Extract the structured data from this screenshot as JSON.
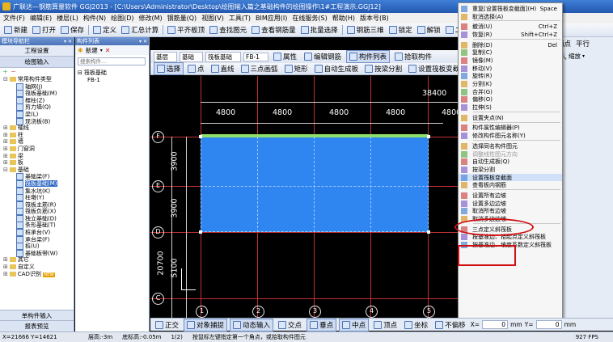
{
  "window": {
    "title": "广联达—钢筋算量软件 GGJ2013 - [C:\\Users\\Administrator\\Desktop\\绘图输入篇之基础构件的绘图操作\\1#工程演示.GGJ12]"
  },
  "menubar": [
    "文件(F)",
    "编辑(E)",
    "楼层(L)",
    "构件(N)",
    "绘图(D)",
    "修改(M)",
    "钢筋量(Q)",
    "视图(V)",
    "工具(T)",
    "BIM应用(I)",
    "在线服务(S)",
    "帮助(H)",
    "版本号(B)"
  ],
  "toolbar1": [
    "新建",
    "打开",
    "保存",
    "定义",
    "汇总计算",
    "平齐板顶",
    "查找图元",
    "查看钢筋量",
    "批量选择",
    "钢筋三维",
    "锁定",
    "解锁",
    "二维",
    "俯视",
    "动态观察"
  ],
  "toolbar2_right": [
    "两点",
    "平行",
    "点角",
    "三点辅轴",
    "删除辅轴",
    "尺寸标注"
  ],
  "nav_panel": {
    "title": "模块导航栏",
    "tabs": [
      "工程设置",
      "绘图输入"
    ],
    "bottom_tabs": [
      "单构件输入",
      "报表预览"
    ],
    "tree": [
      {
        "label": "常用构件类型",
        "level": 0,
        "exp": "-"
      },
      {
        "label": "轴网(J)",
        "level": 2
      },
      {
        "label": "筏板基础(M)",
        "level": 2
      },
      {
        "label": "框柱(Z)",
        "level": 2
      },
      {
        "label": "剪力墙(Q)",
        "level": 2
      },
      {
        "label": "梁(L)",
        "level": 2
      },
      {
        "label": "现浇板(B)",
        "level": 2
      },
      {
        "label": "轴线",
        "level": 0,
        "exp": "+"
      },
      {
        "label": "柱",
        "level": 0,
        "exp": "+"
      },
      {
        "label": "墙",
        "level": 0,
        "exp": "+"
      },
      {
        "label": "门窗洞",
        "level": 0,
        "exp": "+"
      },
      {
        "label": "梁",
        "level": 0,
        "exp": "+"
      },
      {
        "label": "板",
        "level": 0,
        "exp": "+"
      },
      {
        "label": "基础",
        "level": 0,
        "exp": "-"
      },
      {
        "label": "基础梁(F)",
        "level": 2
      },
      {
        "label": "筏板基础(M)",
        "level": 2,
        "sel": true
      },
      {
        "label": "集水坑(K)",
        "level": 2
      },
      {
        "label": "柱墩(Y)",
        "level": 2
      },
      {
        "label": "筏板主筋(R)",
        "level": 2
      },
      {
        "label": "筏板负筋(X)",
        "level": 2
      },
      {
        "label": "独立基础(D)",
        "level": 2
      },
      {
        "label": "条形基础(T)",
        "level": 2
      },
      {
        "label": "桩承台(V)",
        "level": 2
      },
      {
        "label": "承台梁(F)",
        "level": 2
      },
      {
        "label": "桩(U)",
        "level": 2
      },
      {
        "label": "基础板带(W)",
        "level": 2
      },
      {
        "label": "其它",
        "level": 0,
        "exp": "+"
      },
      {
        "label": "自定义",
        "level": 0,
        "exp": "+"
      },
      {
        "label": "CAD识别",
        "level": 0,
        "exp": "+",
        "badge": "NEW"
      }
    ]
  },
  "component_panel": {
    "title": "构件列表",
    "new_label": "新建",
    "search_placeholder": "搜索构件...",
    "tree": [
      {
        "label": "筏板基础",
        "level": 0,
        "exp": "-"
      },
      {
        "label": "FB-1",
        "level": 1
      }
    ]
  },
  "layer_bar": {
    "floor": "基层",
    "type": "基础",
    "category": "筏板基础",
    "component": "FB-1",
    "buttons": [
      "属性",
      "编辑钢筋",
      "构件列表",
      "拾取构件"
    ]
  },
  "draw_bar": [
    "选择",
    "点",
    "直线",
    "三点画弧",
    "矩形",
    "自动生成板",
    "按梁分割",
    "设置筏板变截面",
    "查看板内钢筋"
  ],
  "drawing": {
    "top_total": "38400",
    "top_dims": [
      "4800",
      "4800",
      "4800",
      "4800",
      "4800"
    ],
    "left_dims": [
      "3900",
      "3900",
      "5100"
    ],
    "left_total": "20700",
    "left_axes": [
      "F",
      "E",
      "D",
      "C"
    ],
    "bottom_axes": [
      "1",
      "2",
      "3",
      "4",
      "5"
    ]
  },
  "context_menu": [
    {
      "label": "重复[设置筏板变截面](H)",
      "shortcut": "Space"
    },
    {
      "label": "取消选择(A)"
    },
    {
      "sep": true
    },
    {
      "label": "撤消(U)",
      "shortcut": "Ctrl+Z"
    },
    {
      "label": "恢复(R)",
      "shortcut": "Shift+Ctrl+Z"
    },
    {
      "sep": true
    },
    {
      "label": "删除(D)",
      "shortcut": "Del"
    },
    {
      "label": "复制(C)"
    },
    {
      "label": "镜像(M)"
    },
    {
      "label": "移动(V)"
    },
    {
      "label": "旋转(R)"
    },
    {
      "label": "分割(K)"
    },
    {
      "label": "合并(G)"
    },
    {
      "label": "偏移(O)"
    },
    {
      "label": "拉伸(S)"
    },
    {
      "sep": true
    },
    {
      "label": "设置夹点(N)"
    },
    {
      "sep": true
    },
    {
      "label": "构件属性编辑器(P)"
    },
    {
      "label": "修改构件图元名称(Y)"
    },
    {
      "sep": true
    },
    {
      "label": "选择同名构件图元"
    },
    {
      "label": "调整线性图元方向",
      "disabled": true
    },
    {
      "label": "自动生成板(Q)"
    },
    {
      "label": "按梁分割"
    },
    {
      "label": "设置筏板变截面",
      "highlight": true
    },
    {
      "label": "查看板内钢筋"
    },
    {
      "sep": true
    },
    {
      "label": "设置所有边坡"
    },
    {
      "label": "设置多边边坡"
    },
    {
      "label": "取消所有边坡"
    },
    {
      "label": "取消多边边坡"
    },
    {
      "sep": true
    },
    {
      "label": "三点定义斜筏板"
    },
    {
      "label": "按基准边、抬起点定义斜筏板"
    },
    {
      "label": "按基准边、坡度系数定义斜筏板"
    }
  ],
  "status_bar": {
    "coords": "X=21666  Y=14621",
    "floor_height": "层高:-3m",
    "bottom_elev": "底标高:-0.05m",
    "count": "1(2)",
    "hint": "按鼠标左键指定第一个角点，或拾取构件图元",
    "fps": "927 FPS"
  },
  "snap_bar": [
    "正交",
    "对象捕捉",
    "动态输入",
    "交点",
    "垂点",
    "中点",
    "顶点",
    "坐标",
    "不偏移"
  ],
  "snap_fields": {
    "x_label": "X=",
    "x_value": "0",
    "y_label": "Y=",
    "y_value": "0",
    "unit": "mm"
  },
  "right_toolbar": [
    "缩放"
  ],
  "colors": {
    "slab_fill": "#2f86f0",
    "grid_red": "#c03030",
    "menu_highlight_ring": "#d01010",
    "title_bar": "#2b6cc4",
    "panel_header": "#5b84c6",
    "selected_tree": "#316ac5"
  }
}
